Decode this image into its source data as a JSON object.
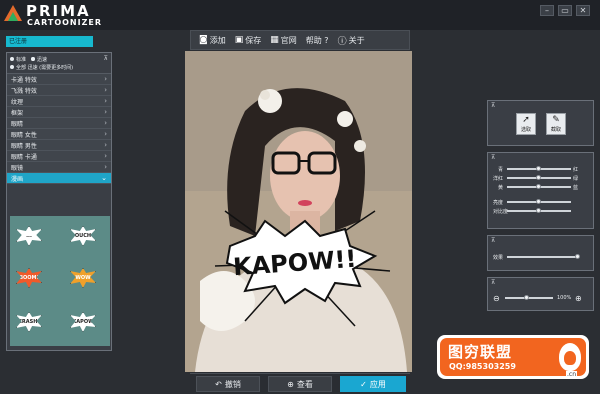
{
  "app": {
    "logo_name": "PRIMA",
    "logo_sub": "CARTOONIZER",
    "window_buttons": {
      "minimize": "–",
      "maximize": "▭",
      "close": "✕"
    }
  },
  "toolbar": {
    "add": "添加",
    "save": "保存",
    "site": "官网",
    "help": "帮助 ?",
    "about": "关于",
    "icons": {
      "add": "camera-icon",
      "save": "floppy-disk-icon",
      "site": "grid-icon",
      "about": "info-circle-icon"
    }
  },
  "left": {
    "registered": "已注册",
    "modes": {
      "standard": "标准",
      "quick": "迅速",
      "full": "全部 迅速 (需要更多时间)"
    },
    "categories": [
      "卡通 特效",
      "飞溅 特效",
      "纹理",
      "框架",
      "眼睛",
      "眼睛 女性",
      "眼睛 男性",
      "眼睛 卡通",
      "眼镜",
      "漫画"
    ],
    "active_index": 9,
    "thumbs": [
      "...",
      "OUCH",
      "BOOM!",
      "WOW",
      "CRASH!",
      "KAPOW"
    ]
  },
  "canvas": {
    "kapow": "KAPOW!!"
  },
  "bottom": {
    "undo": "撤销",
    "view": "查看",
    "apply": "应用"
  },
  "right": {
    "select_panel": {
      "select": "选取",
      "capture": "截取"
    },
    "color_panel": {
      "rows": [
        {
          "left": "青",
          "right": "红",
          "value": 0.5
        },
        {
          "left": "洋红",
          "right": "绿",
          "value": 0.5
        },
        {
          "left": "黄",
          "right": "蓝",
          "value": 0.5
        },
        {
          "left": "亮度",
          "right": "",
          "value": 0.5
        },
        {
          "left": "对比度",
          "right": "",
          "value": 0.5
        }
      ]
    },
    "effect_panel": {
      "label": "效果",
      "value": 1.0
    },
    "zoom_panel": {
      "zoom": "100%",
      "value": 0.45
    }
  },
  "watermark": {
    "title": "图穷联盟",
    "qq": "QQ:985303259",
    "suffix": ".cn"
  }
}
